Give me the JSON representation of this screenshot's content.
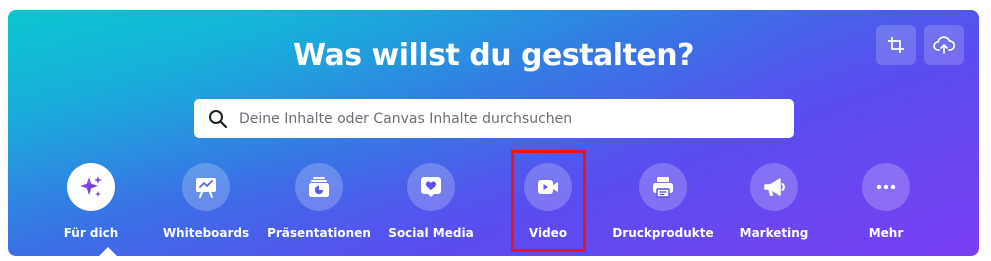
{
  "hero": {
    "title": "Was willst du gestalten?",
    "gradient_colors": [
      "#0fc2cf",
      "#3b6fe6",
      "#7a3ff2"
    ]
  },
  "toolbar": {
    "crop_icon": "crop-icon",
    "upload_icon": "cloud-upload-icon"
  },
  "search": {
    "placeholder": "Deine Inhalte oder Canvas Inhalte durchsuchen",
    "icon": "search-icon"
  },
  "categories": [
    {
      "label": "Für dich",
      "icon": "sparkles-icon",
      "active": true
    },
    {
      "label": "Whiteboards",
      "icon": "whiteboard-icon",
      "active": false
    },
    {
      "label": "Präsentationen",
      "icon": "presentation-icon",
      "active": false
    },
    {
      "label": "Social Media",
      "icon": "heart-icon",
      "active": false
    },
    {
      "label": "Video",
      "icon": "video-camera-icon",
      "active": false
    },
    {
      "label": "Druckprodukte",
      "icon": "printer-icon",
      "active": false
    },
    {
      "label": "Marketing",
      "icon": "megaphone-icon",
      "active": false
    },
    {
      "label": "Mehr",
      "icon": "more-icon",
      "active": false
    }
  ],
  "highlight_color": "#e8151b",
  "accent_color": "#7d2ae8"
}
